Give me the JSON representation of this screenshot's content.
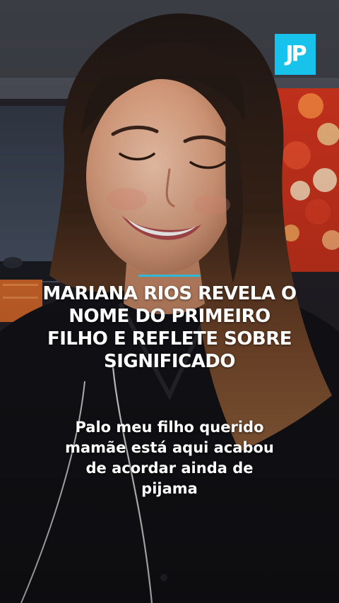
{
  "logo": {
    "text": "JP",
    "color": "#17c3ea"
  },
  "headline": {
    "lines": [
      "MARIANA RIOS REVELA O",
      "NOME DO PRIMEIRO",
      "FILHO E REFLETE SOBRE",
      "SIGNIFICADO"
    ]
  },
  "caption": {
    "lines": [
      "Palo meu filho querido",
      "mamãe está aqui acabou",
      "de acordar ainda de",
      "pijama"
    ]
  }
}
